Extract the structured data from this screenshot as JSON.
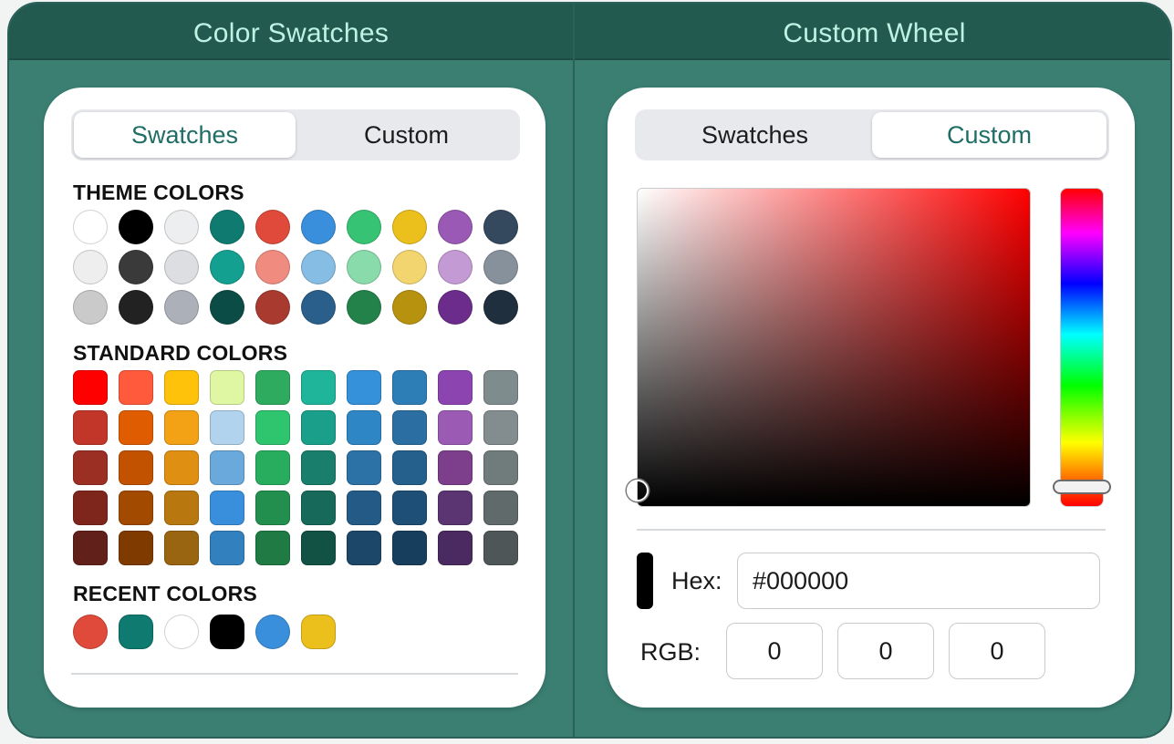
{
  "panels": {
    "left_title": "Color Swatches",
    "right_title": "Custom Wheel"
  },
  "tabs": {
    "swatches": "Swatches",
    "custom": "Custom"
  },
  "swatches_panel": {
    "theme_label": "THEME COLORS",
    "standard_label": "STANDARD COLORS",
    "recent_label": "RECENT COLORS",
    "theme_colors": [
      "#ffffff",
      "#000000",
      "#eceeef",
      "#0e7a70",
      "#e04a3b",
      "#3a8fdc",
      "#36c474",
      "#ecc01c",
      "#9b59b6",
      "#34495e",
      "#eeeeee",
      "#3a3a3a",
      "#dcdee2",
      "#14a090",
      "#ef8b7f",
      "#85bde4",
      "#8adbab",
      "#f2d56f",
      "#c49ad5",
      "#87919b",
      "#cacaca",
      "#222222",
      "#acb0b8",
      "#0b4d46",
      "#a93a2f",
      "#2a5f8c",
      "#23824a",
      "#b7920f",
      "#6c2c8c",
      "#202f3e"
    ],
    "standard_colors": [
      "#ff0000",
      "#ff5a3c",
      "#ffc20a",
      "#dff7a3",
      "#2eab5e",
      "#1fb59a",
      "#3591d9",
      "#2d7db6",
      "#8b44b0",
      "#7f8c8d",
      "#c2362a",
      "#e05c00",
      "#f4a215",
      "#b1d3ed",
      "#2fc46e",
      "#1aa08a",
      "#2e86c4",
      "#2b6fa2",
      "#9b5bb5",
      "#838c8e",
      "#9c2f24",
      "#c25200",
      "#df8f12",
      "#6aa9dc",
      "#28ad5f",
      "#197e6c",
      "#2c72a6",
      "#255f8c",
      "#7d3f8c",
      "#707b7c",
      "#7e261c",
      "#a24a00",
      "#b8780f",
      "#3a8fdc",
      "#238f4e",
      "#176a5a",
      "#245b86",
      "#1e4f77",
      "#5b3572",
      "#606a6b",
      "#62201a",
      "#7f3a00",
      "#9a6510",
      "#3380bf",
      "#1f7a44",
      "#125244",
      "#1c4768",
      "#183e5d",
      "#4a2a60",
      "#4e5657"
    ],
    "recent_colors": [
      "#e04a3b",
      "#0e7a70",
      "#ffffff",
      "#000000",
      "#3a8fdc",
      "#ecc01c"
    ]
  },
  "custom_panel": {
    "hue": "#ff0000",
    "hex_label": "Hex:",
    "hex_value": "#000000",
    "rgb_label": "RGB:",
    "r": "0",
    "g": "0",
    "b": "0"
  }
}
